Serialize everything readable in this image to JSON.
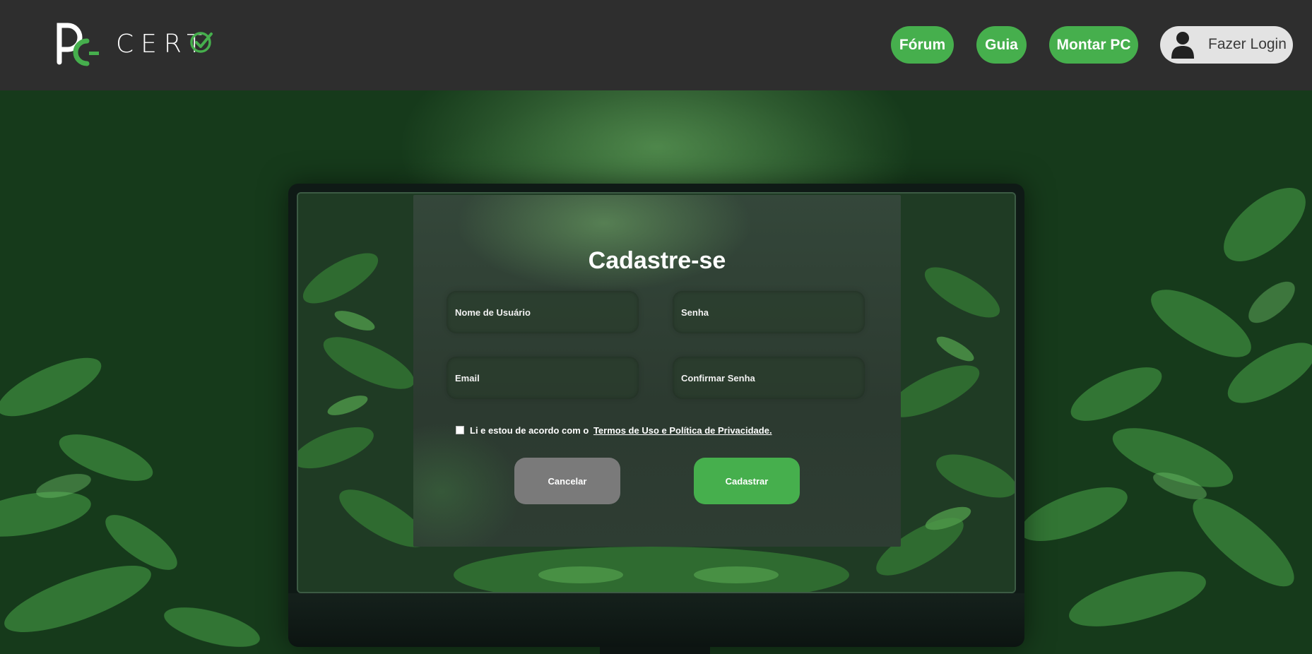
{
  "header": {
    "logo_text": "CERT",
    "nav": {
      "forum": "Fórum",
      "guia": "Guia",
      "montar": "Montar PC"
    },
    "login_label": "Fazer Login"
  },
  "form": {
    "title": "Cadastre-se",
    "username_placeholder": "Nome de Usuário",
    "password_placeholder": "Senha",
    "email_placeholder": "Email",
    "confirm_placeholder": "Confirmar Senha",
    "terms_text": "Li e estou de acordo com o",
    "terms_link": "Termos de Uso e Política de Privacidade.",
    "cancel_label": "Cancelar",
    "submit_label": "Cadastrar"
  },
  "colors": {
    "accent": "#46af4d",
    "header_bg": "#2e2e2e",
    "cancel": "#7a7a7a"
  }
}
